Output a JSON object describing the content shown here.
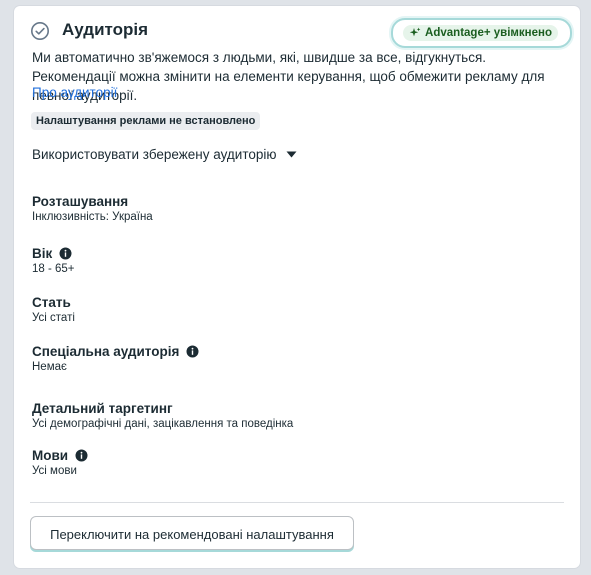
{
  "header": {
    "title": "Аудиторія",
    "advantage_badge": "Advantage+ увімкнено"
  },
  "description": "Ми автоматично зв'яжемося з людьми, які, швидше за все, відгукнуться. Рекомендації можна змінити на елементи керування, щоб обмежити рекламу для певної аудиторії.",
  "about_link": "Про аудиторії",
  "settings_badge": "Налаштування реклами не встановлено",
  "saved_audience": "Використовувати збережену аудиторію",
  "sections": [
    {
      "title": "Розташування",
      "value": "Інклюзивність: Україна",
      "info": false
    },
    {
      "title": "Вік",
      "value": "18 - 65+",
      "info": true
    },
    {
      "title": "Стать",
      "value": "Усі статі",
      "info": false
    },
    {
      "title": "Спеціальна аудиторія",
      "value": "Немає",
      "info": true
    },
    {
      "title": "Детальний таргетинг",
      "value": "Усі демографічні дані, зацікавлення та поведінка",
      "info": false
    },
    {
      "title": "Мови",
      "value": "Усі мови",
      "info": true
    }
  ],
  "switch_button": "Переключити на рекомендовані налаштування",
  "icons": {
    "header": "check-circle-icon",
    "badge": "sparkle-icon",
    "dropdown": "caret-down-icon",
    "info": "info-icon"
  },
  "colors": {
    "link": "#216fdb",
    "badge_text": "#1b5e20",
    "badge_bg": "#e6f4ea",
    "badge_border": "#a6d9d9"
  }
}
